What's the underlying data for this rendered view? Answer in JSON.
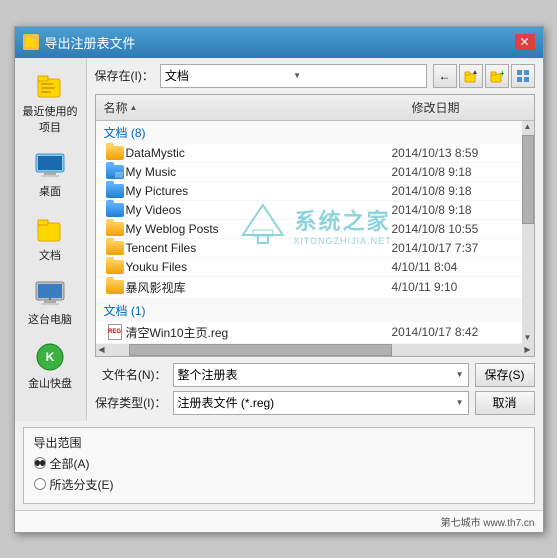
{
  "dialog": {
    "title": "导出注册表文件",
    "close_btn": "✕"
  },
  "sidebar": {
    "items": [
      {
        "id": "recent",
        "label": "最近使用的项目",
        "icon": "recent-icon"
      },
      {
        "id": "desktop",
        "label": "桌面",
        "icon": "desktop-icon"
      },
      {
        "id": "documents",
        "label": "文档",
        "icon": "documents-icon"
      },
      {
        "id": "computer",
        "label": "这台电脑",
        "icon": "computer-icon"
      },
      {
        "id": "wps",
        "label": "金山快盘",
        "icon": "wps-icon"
      }
    ]
  },
  "toolbar": {
    "save_in_label": "保存在(I)：",
    "path_value": "文档",
    "btn_back": "←",
    "btn_up": "↑",
    "btn_folder": "📁",
    "btn_view": "⊞"
  },
  "file_list": {
    "col_name": "名称",
    "col_sort_arrow": "▲",
    "col_date": "修改日期",
    "section1": {
      "header": "文档 (8)",
      "items": [
        {
          "name": "DataMystic",
          "date": "2014/10/13 8:59",
          "type": "folder"
        },
        {
          "name": "My Music",
          "date": "2014/10/8 9:18",
          "type": "folder-special"
        },
        {
          "name": "My Pictures",
          "date": "2014/10/8 9:18",
          "type": "folder-special"
        },
        {
          "name": "My Videos",
          "date": "2014/10/8 9:18",
          "type": "folder-special"
        },
        {
          "name": "My Weblog Posts",
          "date": "2014/10/8 10:55",
          "type": "folder"
        },
        {
          "name": "Tencent Files",
          "date": "2014/10/17 7:37",
          "type": "folder"
        },
        {
          "name": "Youku Files",
          "date": "4/10/11 8:04",
          "type": "folder"
        },
        {
          "name": "暴风影视库",
          "date": "4/10/11 9:10",
          "type": "folder"
        }
      ]
    },
    "section2": {
      "header": "文档 (1)",
      "items": [
        {
          "name": "清空Win10主页.reg",
          "date": "2014/10/17 8:42",
          "type": "reg"
        }
      ]
    }
  },
  "bottom_fields": {
    "filename_label": "文件名(N)：",
    "filename_value": "整个注册表",
    "filetype_label": "保存类型(I)：",
    "filetype_value": "注册表文件 (*.reg)",
    "save_btn": "保存(S)",
    "cancel_btn": "取消"
  },
  "export_scope": {
    "title": "导出范围",
    "option_all": "全部(A)",
    "option_selected": "所选分支(E)"
  },
  "watermark": {
    "text": "系统之家",
    "subtext": "XITONGZHIJIA.NET"
  },
  "bottom_bar": {
    "text": "第七城市  www.th7.cn"
  }
}
